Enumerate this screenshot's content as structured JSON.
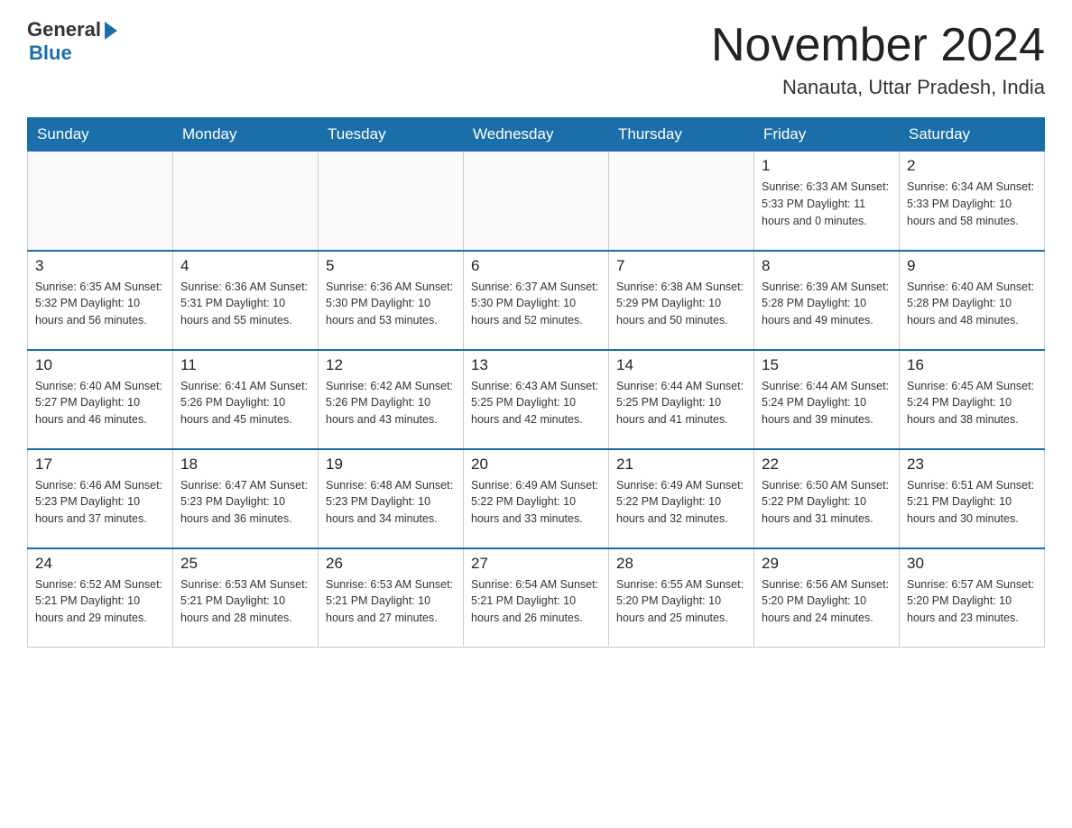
{
  "header": {
    "logo_general": "General",
    "logo_blue": "Blue",
    "month_title": "November 2024",
    "location": "Nanauta, Uttar Pradesh, India"
  },
  "days_of_week": [
    "Sunday",
    "Monday",
    "Tuesday",
    "Wednesday",
    "Thursday",
    "Friday",
    "Saturday"
  ],
  "weeks": [
    [
      {
        "day": "",
        "info": ""
      },
      {
        "day": "",
        "info": ""
      },
      {
        "day": "",
        "info": ""
      },
      {
        "day": "",
        "info": ""
      },
      {
        "day": "",
        "info": ""
      },
      {
        "day": "1",
        "info": "Sunrise: 6:33 AM\nSunset: 5:33 PM\nDaylight: 11 hours\nand 0 minutes."
      },
      {
        "day": "2",
        "info": "Sunrise: 6:34 AM\nSunset: 5:33 PM\nDaylight: 10 hours\nand 58 minutes."
      }
    ],
    [
      {
        "day": "3",
        "info": "Sunrise: 6:35 AM\nSunset: 5:32 PM\nDaylight: 10 hours\nand 56 minutes."
      },
      {
        "day": "4",
        "info": "Sunrise: 6:36 AM\nSunset: 5:31 PM\nDaylight: 10 hours\nand 55 minutes."
      },
      {
        "day": "5",
        "info": "Sunrise: 6:36 AM\nSunset: 5:30 PM\nDaylight: 10 hours\nand 53 minutes."
      },
      {
        "day": "6",
        "info": "Sunrise: 6:37 AM\nSunset: 5:30 PM\nDaylight: 10 hours\nand 52 minutes."
      },
      {
        "day": "7",
        "info": "Sunrise: 6:38 AM\nSunset: 5:29 PM\nDaylight: 10 hours\nand 50 minutes."
      },
      {
        "day": "8",
        "info": "Sunrise: 6:39 AM\nSunset: 5:28 PM\nDaylight: 10 hours\nand 49 minutes."
      },
      {
        "day": "9",
        "info": "Sunrise: 6:40 AM\nSunset: 5:28 PM\nDaylight: 10 hours\nand 48 minutes."
      }
    ],
    [
      {
        "day": "10",
        "info": "Sunrise: 6:40 AM\nSunset: 5:27 PM\nDaylight: 10 hours\nand 46 minutes."
      },
      {
        "day": "11",
        "info": "Sunrise: 6:41 AM\nSunset: 5:26 PM\nDaylight: 10 hours\nand 45 minutes."
      },
      {
        "day": "12",
        "info": "Sunrise: 6:42 AM\nSunset: 5:26 PM\nDaylight: 10 hours\nand 43 minutes."
      },
      {
        "day": "13",
        "info": "Sunrise: 6:43 AM\nSunset: 5:25 PM\nDaylight: 10 hours\nand 42 minutes."
      },
      {
        "day": "14",
        "info": "Sunrise: 6:44 AM\nSunset: 5:25 PM\nDaylight: 10 hours\nand 41 minutes."
      },
      {
        "day": "15",
        "info": "Sunrise: 6:44 AM\nSunset: 5:24 PM\nDaylight: 10 hours\nand 39 minutes."
      },
      {
        "day": "16",
        "info": "Sunrise: 6:45 AM\nSunset: 5:24 PM\nDaylight: 10 hours\nand 38 minutes."
      }
    ],
    [
      {
        "day": "17",
        "info": "Sunrise: 6:46 AM\nSunset: 5:23 PM\nDaylight: 10 hours\nand 37 minutes."
      },
      {
        "day": "18",
        "info": "Sunrise: 6:47 AM\nSunset: 5:23 PM\nDaylight: 10 hours\nand 36 minutes."
      },
      {
        "day": "19",
        "info": "Sunrise: 6:48 AM\nSunset: 5:23 PM\nDaylight: 10 hours\nand 34 minutes."
      },
      {
        "day": "20",
        "info": "Sunrise: 6:49 AM\nSunset: 5:22 PM\nDaylight: 10 hours\nand 33 minutes."
      },
      {
        "day": "21",
        "info": "Sunrise: 6:49 AM\nSunset: 5:22 PM\nDaylight: 10 hours\nand 32 minutes."
      },
      {
        "day": "22",
        "info": "Sunrise: 6:50 AM\nSunset: 5:22 PM\nDaylight: 10 hours\nand 31 minutes."
      },
      {
        "day": "23",
        "info": "Sunrise: 6:51 AM\nSunset: 5:21 PM\nDaylight: 10 hours\nand 30 minutes."
      }
    ],
    [
      {
        "day": "24",
        "info": "Sunrise: 6:52 AM\nSunset: 5:21 PM\nDaylight: 10 hours\nand 29 minutes."
      },
      {
        "day": "25",
        "info": "Sunrise: 6:53 AM\nSunset: 5:21 PM\nDaylight: 10 hours\nand 28 minutes."
      },
      {
        "day": "26",
        "info": "Sunrise: 6:53 AM\nSunset: 5:21 PM\nDaylight: 10 hours\nand 27 minutes."
      },
      {
        "day": "27",
        "info": "Sunrise: 6:54 AM\nSunset: 5:21 PM\nDaylight: 10 hours\nand 26 minutes."
      },
      {
        "day": "28",
        "info": "Sunrise: 6:55 AM\nSunset: 5:20 PM\nDaylight: 10 hours\nand 25 minutes."
      },
      {
        "day": "29",
        "info": "Sunrise: 6:56 AM\nSunset: 5:20 PM\nDaylight: 10 hours\nand 24 minutes."
      },
      {
        "day": "30",
        "info": "Sunrise: 6:57 AM\nSunset: 5:20 PM\nDaylight: 10 hours\nand 23 minutes."
      }
    ]
  ]
}
